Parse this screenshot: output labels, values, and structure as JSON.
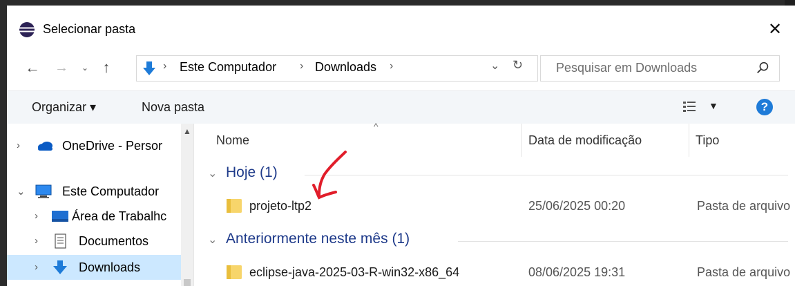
{
  "window": {
    "title": "Selecionar pasta"
  },
  "address": {
    "crumbs": [
      "Este Computador",
      "Downloads"
    ],
    "search_placeholder": "Pesquisar em Downloads"
  },
  "toolbar": {
    "organize": "Organizar ▾",
    "new_folder": "Nova pasta"
  },
  "sidebar": {
    "items": [
      {
        "label": "OneDrive - Persor",
        "icon": "cloud-icon"
      },
      {
        "label": "Este Computador",
        "icon": "computer-icon"
      },
      {
        "label": "Área de Trabalhc",
        "icon": "desktop-icon"
      },
      {
        "label": "Documentos",
        "icon": "document-icon"
      },
      {
        "label": "Downloads",
        "icon": "download-icon"
      }
    ]
  },
  "columns": {
    "name": "Nome",
    "date": "Data de modificação",
    "type": "Tipo"
  },
  "groups": [
    {
      "label": "Hoje (1)",
      "rows": [
        {
          "name": "projeto-ltp2",
          "date": "25/06/2025 00:20",
          "type": "Pasta de arquivo"
        }
      ]
    },
    {
      "label": "Anteriormente neste mês (1)",
      "rows": [
        {
          "name": "eclipse-java-2025-03-R-win32-x86_64",
          "date": "08/06/2025 19:31",
          "type": "Pasta de arquivo"
        }
      ]
    }
  ],
  "colors": {
    "accent": "#1e7bd8",
    "selection": "#cce8ff",
    "group_text": "#1e3a8a",
    "annotation": "#e11d2a"
  }
}
